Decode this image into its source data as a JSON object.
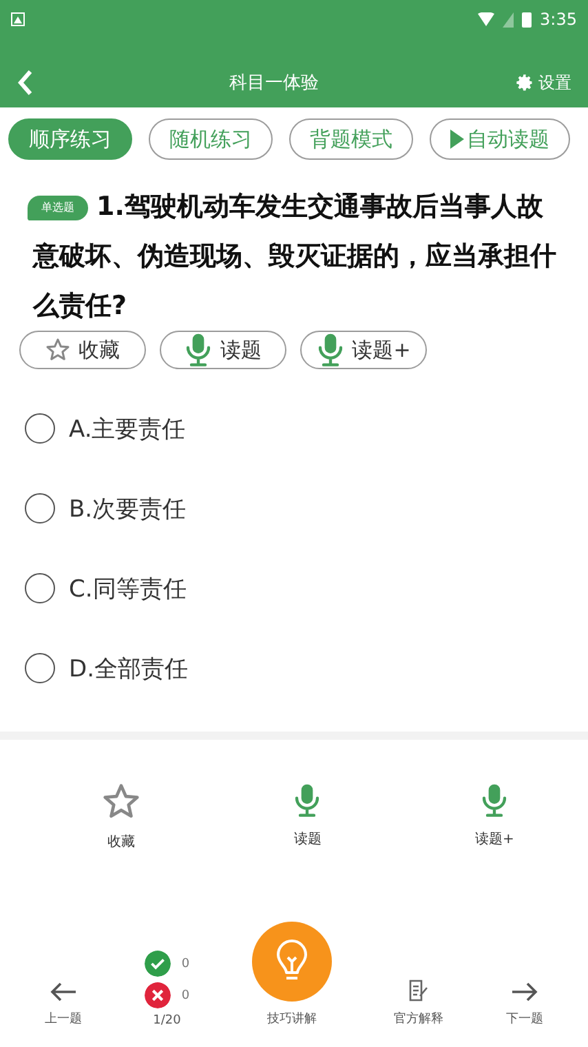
{
  "status_bar": {
    "time": "3:35"
  },
  "header": {
    "title": "科目一体验",
    "settings": "设置"
  },
  "modes": [
    {
      "label": "顺序练习",
      "selected": true,
      "kind": "text"
    },
    {
      "label": "随机练习",
      "selected": false,
      "kind": "text"
    },
    {
      "label": "背题模式",
      "selected": false,
      "kind": "text"
    },
    {
      "label": "自动读题",
      "selected": false,
      "kind": "play"
    }
  ],
  "question": {
    "type_badge": "单选题",
    "text": "1.驾驶机动车发生交通事故后当事人故意破坏、伪造现场、毁灭证据的，应当承担什么责任?"
  },
  "question_actions": [
    {
      "kind": "star",
      "label": "收藏"
    },
    {
      "kind": "mic",
      "label": "读题"
    },
    {
      "kind": "mic",
      "label": "读题+"
    }
  ],
  "options": [
    {
      "label": "A.主要责任",
      "selected": false
    },
    {
      "label": "B.次要责任",
      "selected": false
    },
    {
      "label": "C.同等责任",
      "selected": false
    },
    {
      "label": "D.全部责任",
      "selected": false
    }
  ],
  "bottom_actions": [
    {
      "kind": "star",
      "label": "收藏"
    },
    {
      "kind": "mic",
      "label": "读题"
    },
    {
      "kind": "mic",
      "label": "读题+"
    }
  ],
  "footer": {
    "prev": "上一题",
    "correct": "0",
    "wrong": "0",
    "progress": "1/20",
    "tips": "技巧讲解",
    "official": "官方解释",
    "next": "下一题"
  }
}
